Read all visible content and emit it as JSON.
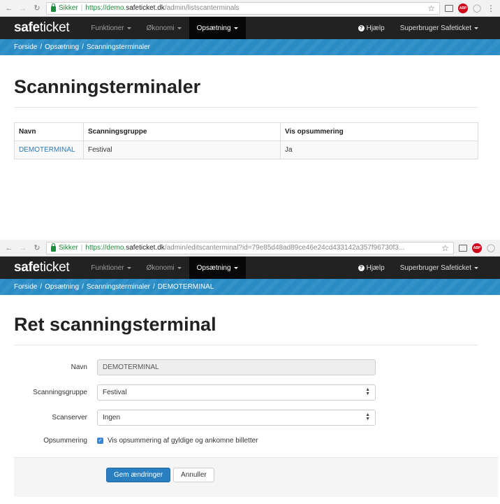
{
  "screen1": {
    "browser": {
      "secure_label": "Sikker",
      "url_scheme_host": "https://demo.",
      "url_domain": "safeticket.dk",
      "url_path": "/admin/listscanterminals"
    },
    "navbar": {
      "brand_bold": "safe",
      "brand_light": "ticket",
      "menu": [
        "Funktioner",
        "Økonomi",
        "Opsætning"
      ],
      "active_menu": "Opsætning",
      "help": "Hjælp",
      "user": "Superbruger Safeticket"
    },
    "breadcrumb": [
      "Forside",
      "Opsætning",
      "Scanningsterminaler"
    ],
    "title": "Scanningsterminaler",
    "table": {
      "headers": [
        "Navn",
        "Scanningsgruppe",
        "Vis opsummering"
      ],
      "rows": [
        [
          "DEMOTERMINAL",
          "Festival",
          "Ja"
        ]
      ]
    }
  },
  "screen2": {
    "browser": {
      "secure_label": "Sikker",
      "url_scheme_host": "https://demo.",
      "url_domain": "safeticket.dk",
      "url_path": "/admin/editscanterminal?id=79e85d48ad89ce46e24cd433142a357f96730f3..."
    },
    "navbar": {
      "brand_bold": "safe",
      "brand_light": "ticket",
      "menu": [
        "Funktioner",
        "Økonomi",
        "Opsætning"
      ],
      "active_menu": "Opsætning",
      "help": "Hjælp",
      "user": "Superbruger Safeticket"
    },
    "breadcrumb": [
      "Forside",
      "Opsætning",
      "Scanningsterminaler",
      "DEMOTERMINAL"
    ],
    "title": "Ret scanningsterminal",
    "form": {
      "name_label": "Navn",
      "name_value": "DEMOTERMINAL",
      "group_label": "Scanningsgruppe",
      "group_value": "Festival",
      "server_label": "Scanserver",
      "server_value": "Ingen",
      "summary_label": "Opsummering",
      "summary_checkbox_text": "Vis opsummering af gyldige og ankomne billetter",
      "summary_checked": true,
      "save_button": "Gem ændringer",
      "cancel_button": "Annuller"
    }
  },
  "colors": {
    "navbar": "#222222",
    "breadcrumb_band": "#2a8cc5",
    "link": "#2a7ab8",
    "primary_button": "#2a7fc1",
    "secure_green": "#1a8c3a"
  }
}
